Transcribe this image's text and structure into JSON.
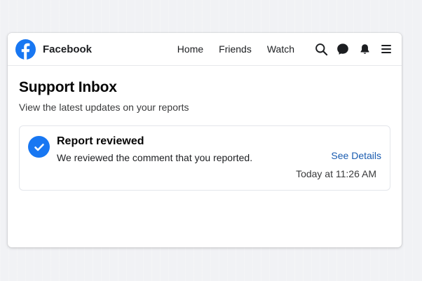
{
  "header": {
    "brand": "Facebook",
    "nav": [
      "Home",
      "Friends",
      "Watch"
    ],
    "icons": [
      "search-icon",
      "messenger-icon",
      "notifications-icon",
      "menu-icon"
    ]
  },
  "main": {
    "title": "Support Inbox",
    "subtitle": "View the latest updates on your reports"
  },
  "notification": {
    "title": "Report reviewed",
    "description": "We reviewed the comment that you reported.",
    "link": "See Details",
    "timestamp": "Today at 11:26 AM"
  },
  "colors": {
    "brand": "#1877f2",
    "link": "#1a5cb0"
  }
}
